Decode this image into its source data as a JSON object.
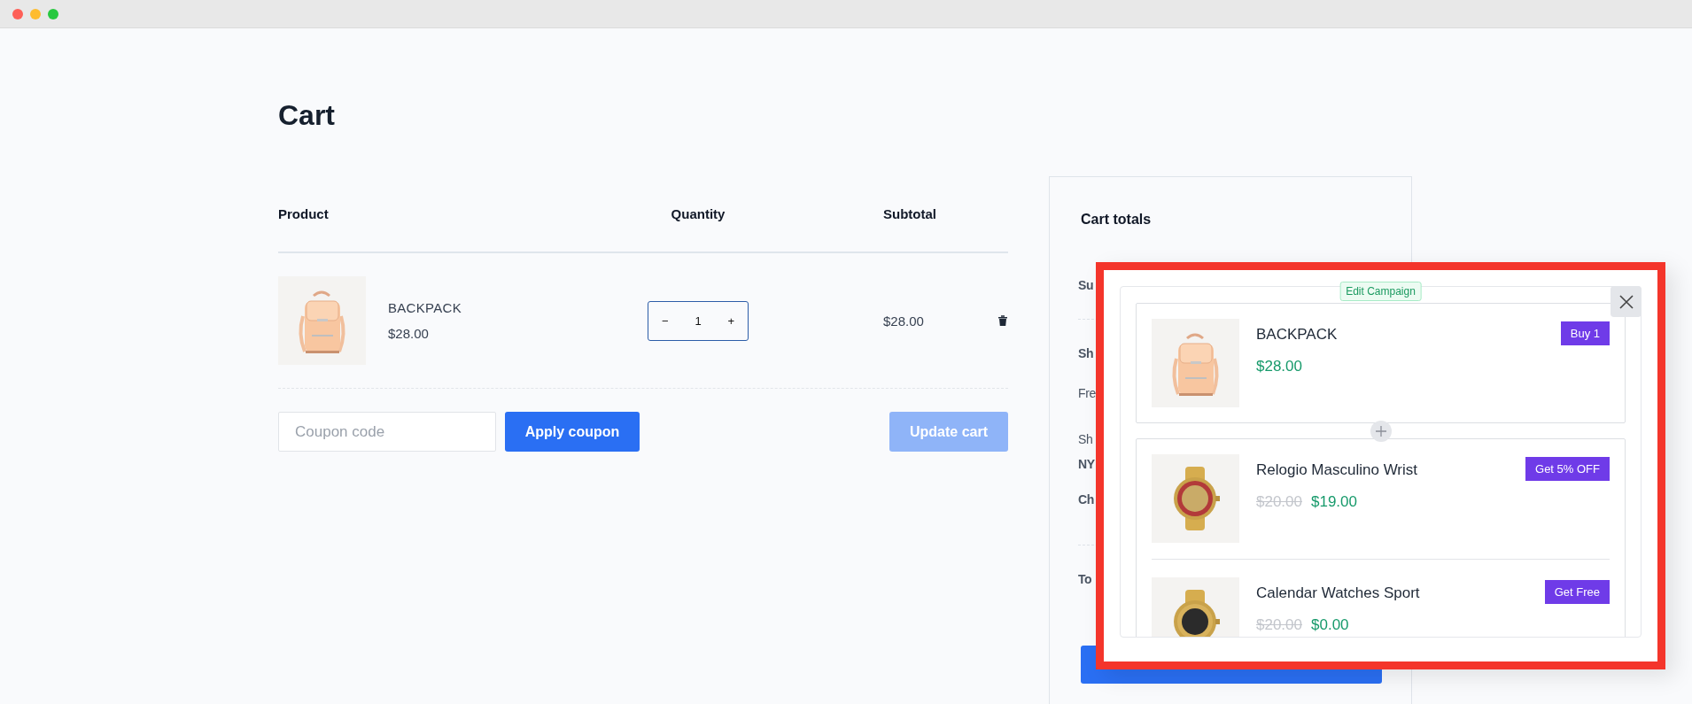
{
  "page": {
    "title": "Cart"
  },
  "cart": {
    "columns": [
      "Product",
      "Quantity",
      "Subtotal"
    ],
    "rows": [
      {
        "product": "BACKPACK",
        "price": "$28.00",
        "decrement": "−",
        "quantity": "1",
        "increment": "+",
        "subtotal": "$28.00"
      }
    ],
    "coupon": {
      "placeholder": "Coupon code"
    },
    "apply_button": "Apply coupon",
    "update_button": {
      "label": "Update cart",
      "disabled": true
    }
  },
  "cart_totals": {
    "title": "Cart totals",
    "sections": [
      [
        {
          "kind": "label",
          "text": "Su"
        }
      ],
      [
        {
          "kind": "label",
          "text": "Sh"
        },
        {
          "kind": "option",
          "text": "Fre"
        },
        {
          "kind": "note",
          "text": "Sh"
        },
        {
          "kind": "value",
          "text": "NY"
        },
        {
          "kind": "label",
          "text": "Ch"
        }
      ],
      [
        {
          "kind": "label",
          "text": "To"
        }
      ]
    ]
  },
  "campaign_popup": {
    "badge": "Edit Campaign",
    "main_offer": {
      "name": "BACKPACK",
      "price": "$28.00",
      "action": "Buy 1"
    },
    "offers": [
      {
        "name": "Relogio Masculino Wrist",
        "old_price": "$20.00",
        "price": "$19.00",
        "action": "Get 5% OFF"
      },
      {
        "name": "Calendar Watches Sport",
        "old_price": "$20.00",
        "price": "$0.00",
        "action": "Get Free"
      }
    ]
  }
}
